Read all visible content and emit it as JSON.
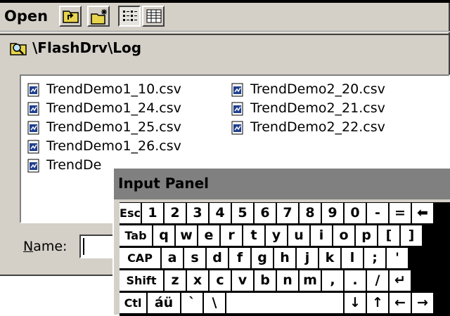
{
  "toolbar": {
    "title": "Open",
    "buttons": [
      {
        "icon": "up-folder-icon"
      },
      {
        "icon": "new-folder-icon"
      },
      {
        "icon": "list-view-icon",
        "pressed": true
      },
      {
        "icon": "details-view-icon"
      }
    ]
  },
  "path": {
    "icon": "folder-search-icon",
    "text": "\\FlashDrv\\Log"
  },
  "files": {
    "col1": [
      "TrendDemo1_10.csv",
      "TrendDemo1_24.csv",
      "TrendDemo1_25.csv",
      "TrendDemo1_26.csv",
      "TrendDe"
    ],
    "col2": [
      "TrendDemo2_20.csv",
      "TrendDemo2_21.csv",
      "TrendDemo2_22.csv"
    ]
  },
  "name_field": {
    "label_prefix": "N",
    "label_rest": "ame:",
    "value": ""
  },
  "input_panel": {
    "title": "Input Panel",
    "rows": [
      [
        "Esc",
        "1",
        "2",
        "3",
        "4",
        "5",
        "6",
        "7",
        "8",
        "9",
        "0",
        "-",
        "=",
        "⬅"
      ],
      [
        "Tab",
        "q",
        "w",
        "e",
        "r",
        "t",
        "y",
        "u",
        "i",
        "o",
        "p",
        "[",
        "]"
      ],
      [
        "CAP",
        "a",
        "s",
        "d",
        "f",
        "g",
        "h",
        "j",
        "k",
        "l",
        ";",
        "'"
      ],
      [
        "Shift",
        "z",
        "x",
        "c",
        "v",
        "b",
        "n",
        "m",
        ",",
        ".",
        "/",
        "↵"
      ],
      [
        "Ctl",
        "áü",
        "`",
        "\\",
        "",
        "↓",
        "↑",
        "←",
        "→"
      ]
    ]
  }
}
